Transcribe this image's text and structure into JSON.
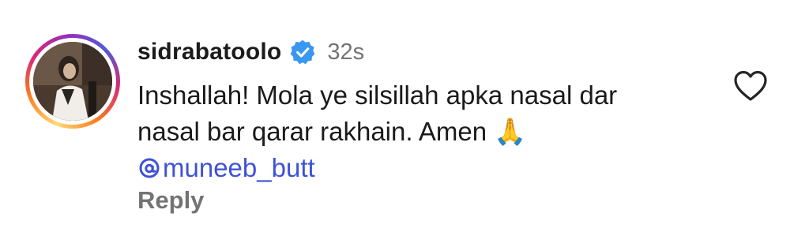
{
  "comment": {
    "username": "sidrabatoolo",
    "timestamp": "32s",
    "text_line1": "Inshallah! Mola ye silsillah apka nasal dar",
    "text_line2": "nasal bar qarar rakhain. Amen",
    "emoji": "🙏",
    "mention": "muneeb_butt",
    "reply_label": "Reply"
  },
  "icons": {
    "verified": "verified-badge-icon",
    "like": "heart-outline-icon",
    "mention_prefix": "threads-at-icon"
  },
  "colors": {
    "verified_blue": "#3897f0",
    "mention_blue": "#3f51d8",
    "secondary_gray": "#737373"
  }
}
